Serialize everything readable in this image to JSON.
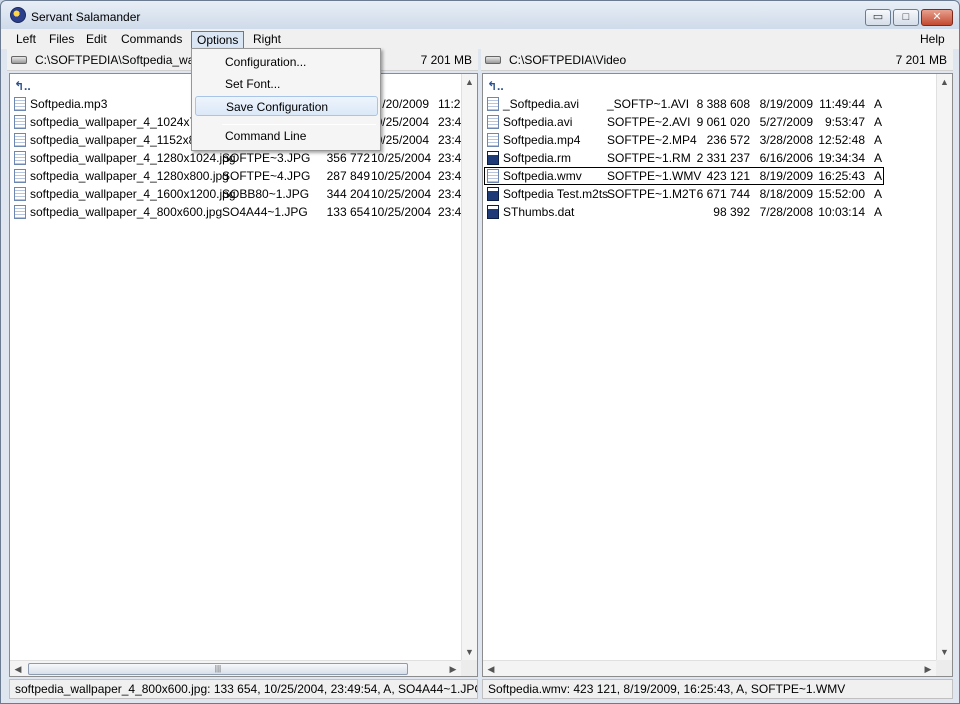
{
  "window": {
    "title": "Servant Salamander",
    "buttons": {
      "minimize": "▭",
      "maximize": "□",
      "close": "✕"
    }
  },
  "menu": {
    "items": [
      "Left",
      "Files",
      "Edit",
      "Commands",
      "Options",
      "Right"
    ],
    "help": "Help",
    "options_dropdown": [
      "Configuration...",
      "Set Font...",
      "Save Configuration",
      "Command Line"
    ]
  },
  "left_panel": {
    "path": "C:\\SOFTPEDIA\\Softpedia_wallp",
    "free_space": "7 201 MB",
    "updir": "↰..",
    "files": [
      {
        "name": "Softpedia.mp3",
        "dos": "",
        "size": "",
        "date": "/20/2009",
        "time": "11:2"
      },
      {
        "name": "softpedia_wallpaper_4_1024x768",
        "dos": "",
        "size": "",
        "date": "0/25/2004",
        "time": "23:4"
      },
      {
        "name": "softpedia_wallpaper_4_1152x864",
        "dos": "",
        "size": "",
        "date": "0/25/2004",
        "time": "23:4"
      },
      {
        "name": "softpedia_wallpaper_4_1280x1024.jpg",
        "dos": "SOFTPE~3.JPG",
        "size": "356 772",
        "date": "10/25/2004",
        "time": "23:4"
      },
      {
        "name": "softpedia_wallpaper_4_1280x800.jpg",
        "dos": "SOFTPE~4.JPG",
        "size": "287 849",
        "date": "10/25/2004",
        "time": "23:4"
      },
      {
        "name": "softpedia_wallpaper_4_1600x1200.jpg",
        "dos": "SOBB80~1.JPG",
        "size": "344 204",
        "date": "10/25/2004",
        "time": "23:4"
      },
      {
        "name": "softpedia_wallpaper_4_800x600.jpg",
        "dos": "SO4A44~1.JPG",
        "size": "133 654",
        "date": "10/25/2004",
        "time": "23:4"
      }
    ],
    "status": "softpedia_wallpaper_4_800x600.jpg: 133 654, 10/25/2004, 23:49:54, A, SO4A44~1.JPG"
  },
  "right_panel": {
    "path": "C:\\SOFTPEDIA\\Video",
    "free_space": "7 201 MB",
    "updir": "↰..",
    "files": [
      {
        "name": "_Softpedia.avi",
        "dos": "_SOFTP~1.AVI",
        "size": "8 388 608",
        "date": "8/19/2009",
        "time": "11:49:44",
        "attr": "A",
        "icon": "doc"
      },
      {
        "name": "Softpedia.avi",
        "dos": "SOFTPE~2.AVI",
        "size": "9 061 020",
        "date": "5/27/2009",
        "time": "9:53:47",
        "attr": "A",
        "icon": "doc"
      },
      {
        "name": "Softpedia.mp4",
        "dos": "SOFTPE~2.MP4",
        "size": "236 572",
        "date": "3/28/2008",
        "time": "12:52:48",
        "attr": "A",
        "icon": "doc"
      },
      {
        "name": "Softpedia.rm",
        "dos": "SOFTPE~1.RM",
        "size": "2 331 237",
        "date": "6/16/2006",
        "time": "19:34:34",
        "attr": "A",
        "icon": "media"
      },
      {
        "name": "Softpedia.wmv",
        "dos": "SOFTPE~1.WMV",
        "size": "423 121",
        "date": "8/19/2009",
        "time": "16:25:43",
        "attr": "A",
        "icon": "doc"
      },
      {
        "name": "Softpedia Test.m2ts",
        "dos": "SOFTPE~1.M2T",
        "size": "6 671 744",
        "date": "8/18/2009",
        "time": "15:52:00",
        "attr": "A",
        "icon": "media"
      },
      {
        "name": "SThumbs.dat",
        "dos": "",
        "size": "98 392",
        "date": "7/28/2008",
        "time": "10:03:14",
        "attr": "A",
        "icon": "media"
      }
    ],
    "selected_index": 4,
    "status": "Softpedia.wmv: 423 121, 8/19/2009, 16:25:43, A, SOFTPE~1.WMV"
  },
  "scroll": {
    "up": "▲",
    "down": "▼",
    "left": "◀",
    "right": "▶",
    "grip": "|||"
  }
}
